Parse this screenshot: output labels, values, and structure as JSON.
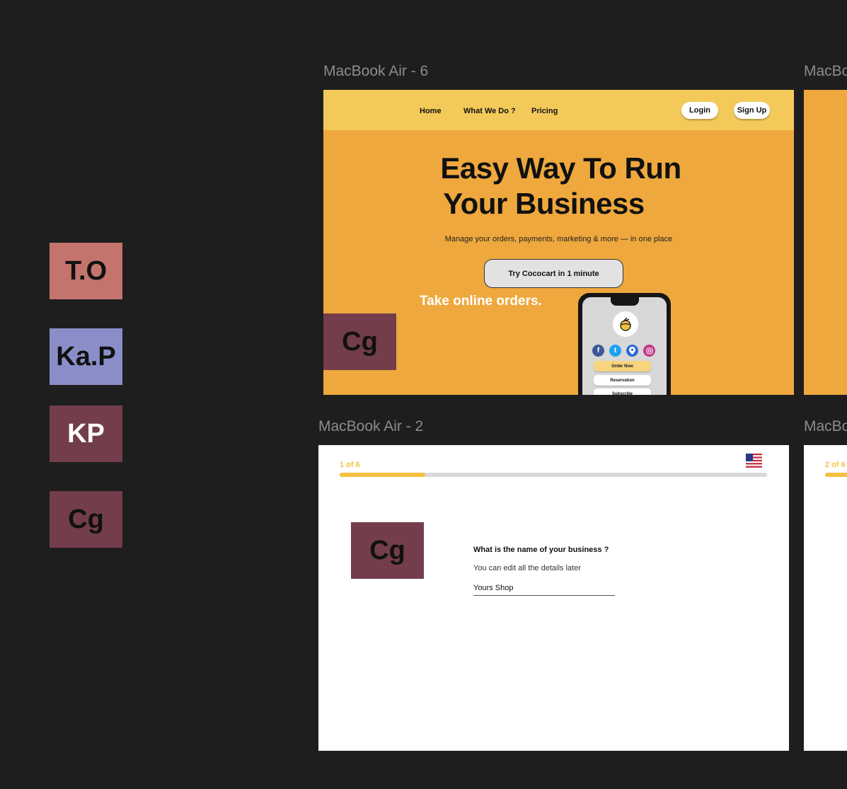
{
  "canvas": {
    "colors": {
      "background": "#1e1e1e",
      "label": "#8c8c8c"
    },
    "frames": [
      {
        "label": "MacBook Air - 6"
      },
      {
        "label": "MacBook Air - 2"
      },
      {
        "label": "MacBo"
      },
      {
        "label": "MacBo"
      }
    ]
  },
  "collaborators": [
    {
      "initials": "T.O",
      "color": "#c4746c",
      "text_color": "#111111"
    },
    {
      "initials": "Ka.P",
      "color": "#8a8ec8",
      "text_color": "#111111"
    },
    {
      "initials": "KP",
      "color": "#733d4b",
      "text_color": "#ffffff"
    },
    {
      "initials": "Cg",
      "color": "#733d4b",
      "text_color": "#111111"
    }
  ],
  "landing": {
    "nav": {
      "home": "Home",
      "what": "What We Do ?",
      "pricing": "Pricing",
      "login": "Login",
      "signup": "Sign Up"
    },
    "hero": {
      "title_line1": "Easy Way To Run",
      "title_line2": "Your Business",
      "subtitle": "Manage your orders, payments, marketing & more — in one place",
      "cta": "Try Cococart in 1 minute",
      "tagline": "Take online orders."
    },
    "phone": {
      "social_icons": [
        "facebook-icon",
        "twitter-icon",
        "location-pin-icon",
        "instagram-icon"
      ],
      "buttons": [
        "Order Now",
        "Reservation",
        "Subscribe"
      ]
    },
    "cursor_badge": "Cg",
    "colors": {
      "nav": "#f3ca59",
      "body": "#eea83d",
      "order_now": "#f6d57e"
    }
  },
  "onboarding": {
    "step": "1 of 6",
    "progress": 0.2,
    "question": "What is the name of your business ?",
    "hint": "You can edit all the details later",
    "input_value": "Yours Shop",
    "cursor_badge": "Cg",
    "flag_icon": "us-flag-icon",
    "accent": "#f4c142"
  },
  "onboarding_next": {
    "step": "2 of 6"
  }
}
